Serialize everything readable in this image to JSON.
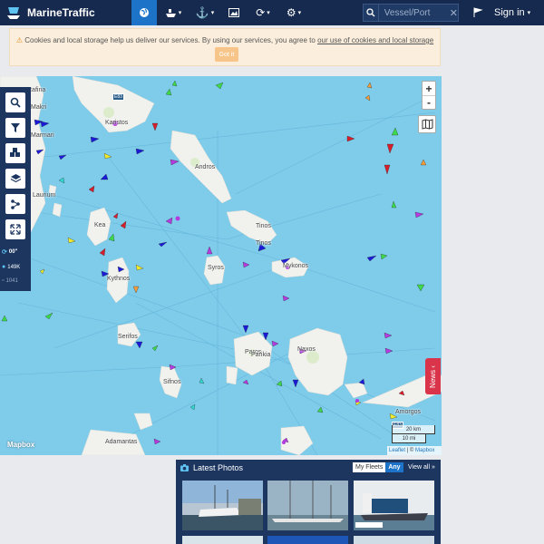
{
  "app": {
    "brand": "MarineTraffic"
  },
  "navbar": {
    "items": [
      {
        "name": "live-map",
        "icon": "globe-icon",
        "active": true
      },
      {
        "name": "vessels",
        "icon": "ship-icon",
        "caret": "▾"
      },
      {
        "name": "ports",
        "icon": "anchor-icon",
        "caret": "▾"
      },
      {
        "name": "photos",
        "icon": "image-icon"
      },
      {
        "name": "fleet",
        "icon": "refresh-icon",
        "caret": "▾"
      },
      {
        "name": "settings",
        "icon": "gear-icon",
        "caret": "▾"
      }
    ],
    "search_placeholder": "Vessel/Port",
    "signin_label": "Sign in",
    "signin_caret": "▾"
  },
  "cookie": {
    "text": "Cookies and local storage help us deliver our services. By using our services, you agree to",
    "link_text": "our use of cookies and local storage",
    "button": "Got it"
  },
  "map": {
    "labels": [
      {
        "text": "Karistos",
        "l": 116,
        "t": 132
      },
      {
        "text": "Andros",
        "l": 215,
        "t": 181
      },
      {
        "text": "Tinos",
        "l": 282,
        "t": 246
      },
      {
        "text": "Tinos",
        "l": 282,
        "t": 265
      },
      {
        "text": "Mykonos",
        "l": 312,
        "t": 290
      },
      {
        "text": "Kea",
        "l": 104,
        "t": 245
      },
      {
        "text": "Kythnos",
        "l": 118,
        "t": 304
      },
      {
        "text": "Syros",
        "l": 229,
        "t": 292
      },
      {
        "text": "Serifos",
        "l": 130,
        "t": 368
      },
      {
        "text": "Sifnos",
        "l": 180,
        "t": 418
      },
      {
        "text": "Paros",
        "l": 270,
        "t": 385
      },
      {
        "text": "Parikia",
        "l": 277,
        "t": 388
      },
      {
        "text": "Naxos",
        "l": 328,
        "t": 382
      },
      {
        "text": "Adamantas",
        "l": 116,
        "t": 484
      },
      {
        "text": "Amorgos",
        "l": 436,
        "t": 451
      },
      {
        "text": "Laurium",
        "l": 36,
        "t": 212
      },
      {
        "text": "Makri",
        "l": 34,
        "t": 115
      },
      {
        "text": "Rafina",
        "l": 30,
        "t": 96
      },
      {
        "text": "Marmari",
        "l": 34,
        "t": 146
      }
    ],
    "zoom_in": "+",
    "zoom_out": "-",
    "news_label": "News ‹",
    "scale_km": "20 km",
    "scale_mi": "10 mi",
    "attribution_leaflet": "Leaflet",
    "attribution_sep": " | © ",
    "attribution_mapbox": "Mapbox",
    "mapbox_logo": "Mapbox"
  },
  "toolbar": {
    "tools": [
      {
        "name": "search-tool",
        "icon": "magnifier-icon"
      },
      {
        "name": "filter-tool",
        "icon": "funnel-icon"
      },
      {
        "name": "fleet-tool",
        "icon": "boxes-icon"
      },
      {
        "name": "layers-tool",
        "icon": "layers-icon"
      },
      {
        "name": "share-tool",
        "icon": "nodes-icon"
      },
      {
        "name": "fullscreen-tool",
        "icon": "expand-icon"
      }
    ],
    "refresh_value": "00\"",
    "vessel_count": "149K",
    "hidden_count": "1041"
  },
  "photos": {
    "title": "Latest Photos",
    "my_fleets": "My Fleets",
    "any": "Any",
    "view_all": "View all »"
  },
  "colors": {
    "navbar": "#152a4e",
    "accent": "#1d73c8",
    "sea": "#7fcbea",
    "land": "#f1f2ee",
    "news": "#d9344a"
  }
}
